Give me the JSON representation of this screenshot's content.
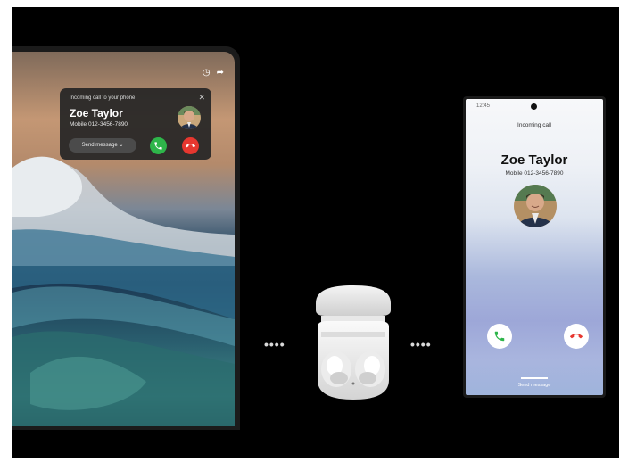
{
  "tablet": {
    "notification": {
      "header": "Incoming call to your phone",
      "close_icon": "close-icon",
      "caller_name": "Zoe Taylor",
      "caller_number": "Mobile  012-3456-7890",
      "send_message_label": "Send message",
      "accept_icon": "phone-accept-icon",
      "decline_icon": "phone-decline-icon"
    },
    "status_icons": [
      "clock-icon",
      "share-icon"
    ]
  },
  "phone": {
    "time": "12:45",
    "incoming_label": "Incoming call",
    "caller_name": "Zoe Taylor",
    "caller_number": "Mobile 012-3456-7890",
    "send_message_label": "Send message",
    "accept_color": "#2eb54a",
    "decline_color": "#e7372f"
  },
  "connector_dots": "••••"
}
